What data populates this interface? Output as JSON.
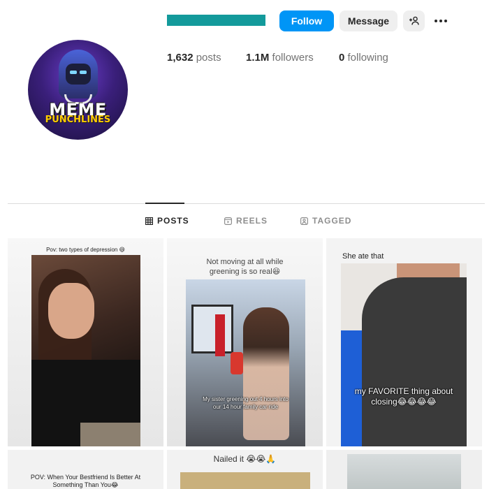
{
  "profile": {
    "username_redacted_color": "#139a9b",
    "avatar_logo": {
      "line1": "MEME",
      "line2": "PUNCHLINES"
    },
    "buttons": {
      "follow": "Follow",
      "message": "Message",
      "suggest_icon": "person-plus-icon",
      "more_icon": "more-horizontal-icon"
    },
    "stats": {
      "posts_value": "1,632",
      "posts_label": "posts",
      "followers_value": "1.1M",
      "followers_label": "followers",
      "following_value": "0",
      "following_label": "following"
    }
  },
  "tabs": [
    {
      "label": "POSTS",
      "icon": "grid-icon",
      "active": true
    },
    {
      "label": "REELS",
      "icon": "reels-icon",
      "active": false
    },
    {
      "label": "TAGGED",
      "icon": "tagged-icon",
      "active": false
    }
  ],
  "posts": [
    {
      "caption": "Pov: two types of depression 😄"
    },
    {
      "caption": "Not moving at all while greening is so real😆",
      "overlay": "My sister greening out 4 hours into our 14 hour family car ride"
    },
    {
      "caption": "She ate that",
      "overlay": "my FAVORITE thing about closing😂😂😂😂"
    },
    {
      "caption": "POV: When Your Bestfriend Is Better At Something Than You😂"
    },
    {
      "caption": "Nailed it 😭😭🙏"
    },
    {
      "caption": ""
    }
  ],
  "colors": {
    "follow_button": "#0095f6",
    "secondary_button": "#efefef",
    "divider": "#dbdbdb"
  }
}
